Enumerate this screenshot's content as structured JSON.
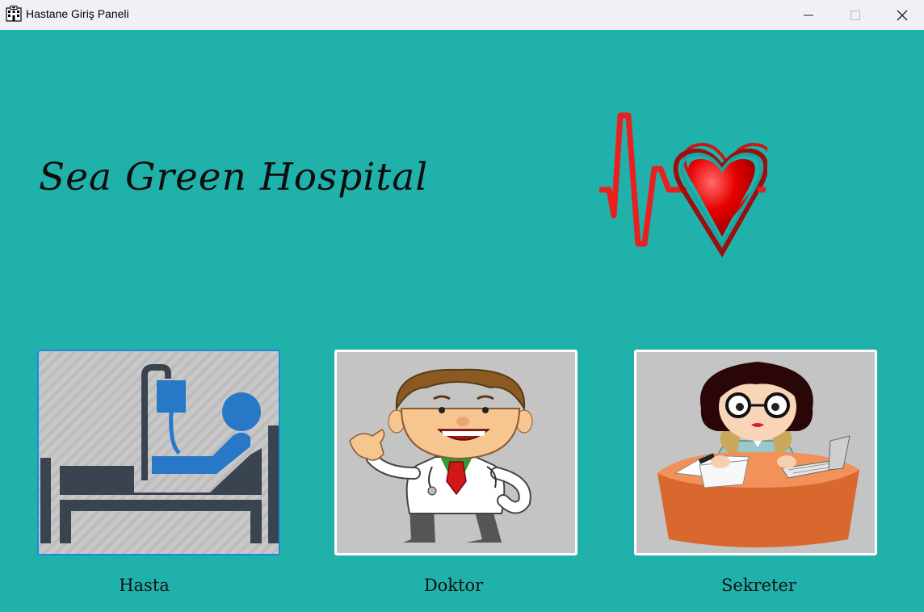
{
  "window": {
    "title": "Hastane Giriş Paneli",
    "minimize_icon": "minimize-icon",
    "maximize_icon": "maximize-icon",
    "close_icon": "close-icon"
  },
  "header": {
    "hospital_name": "Sea Green Hospital",
    "logo_icon": "heartbeat-heart-icon"
  },
  "roles": [
    {
      "label": "Hasta",
      "icon": "patient-bed-icon"
    },
    {
      "label": "Doktor",
      "icon": "doctor-icon"
    },
    {
      "label": "Sekreter",
      "icon": "secretary-icon"
    }
  ],
  "colors": {
    "background": "#20b2aa",
    "titlebar": "#f3eff7",
    "selected_border": "#1a8be0",
    "card_bg": "#c4c4c4"
  }
}
